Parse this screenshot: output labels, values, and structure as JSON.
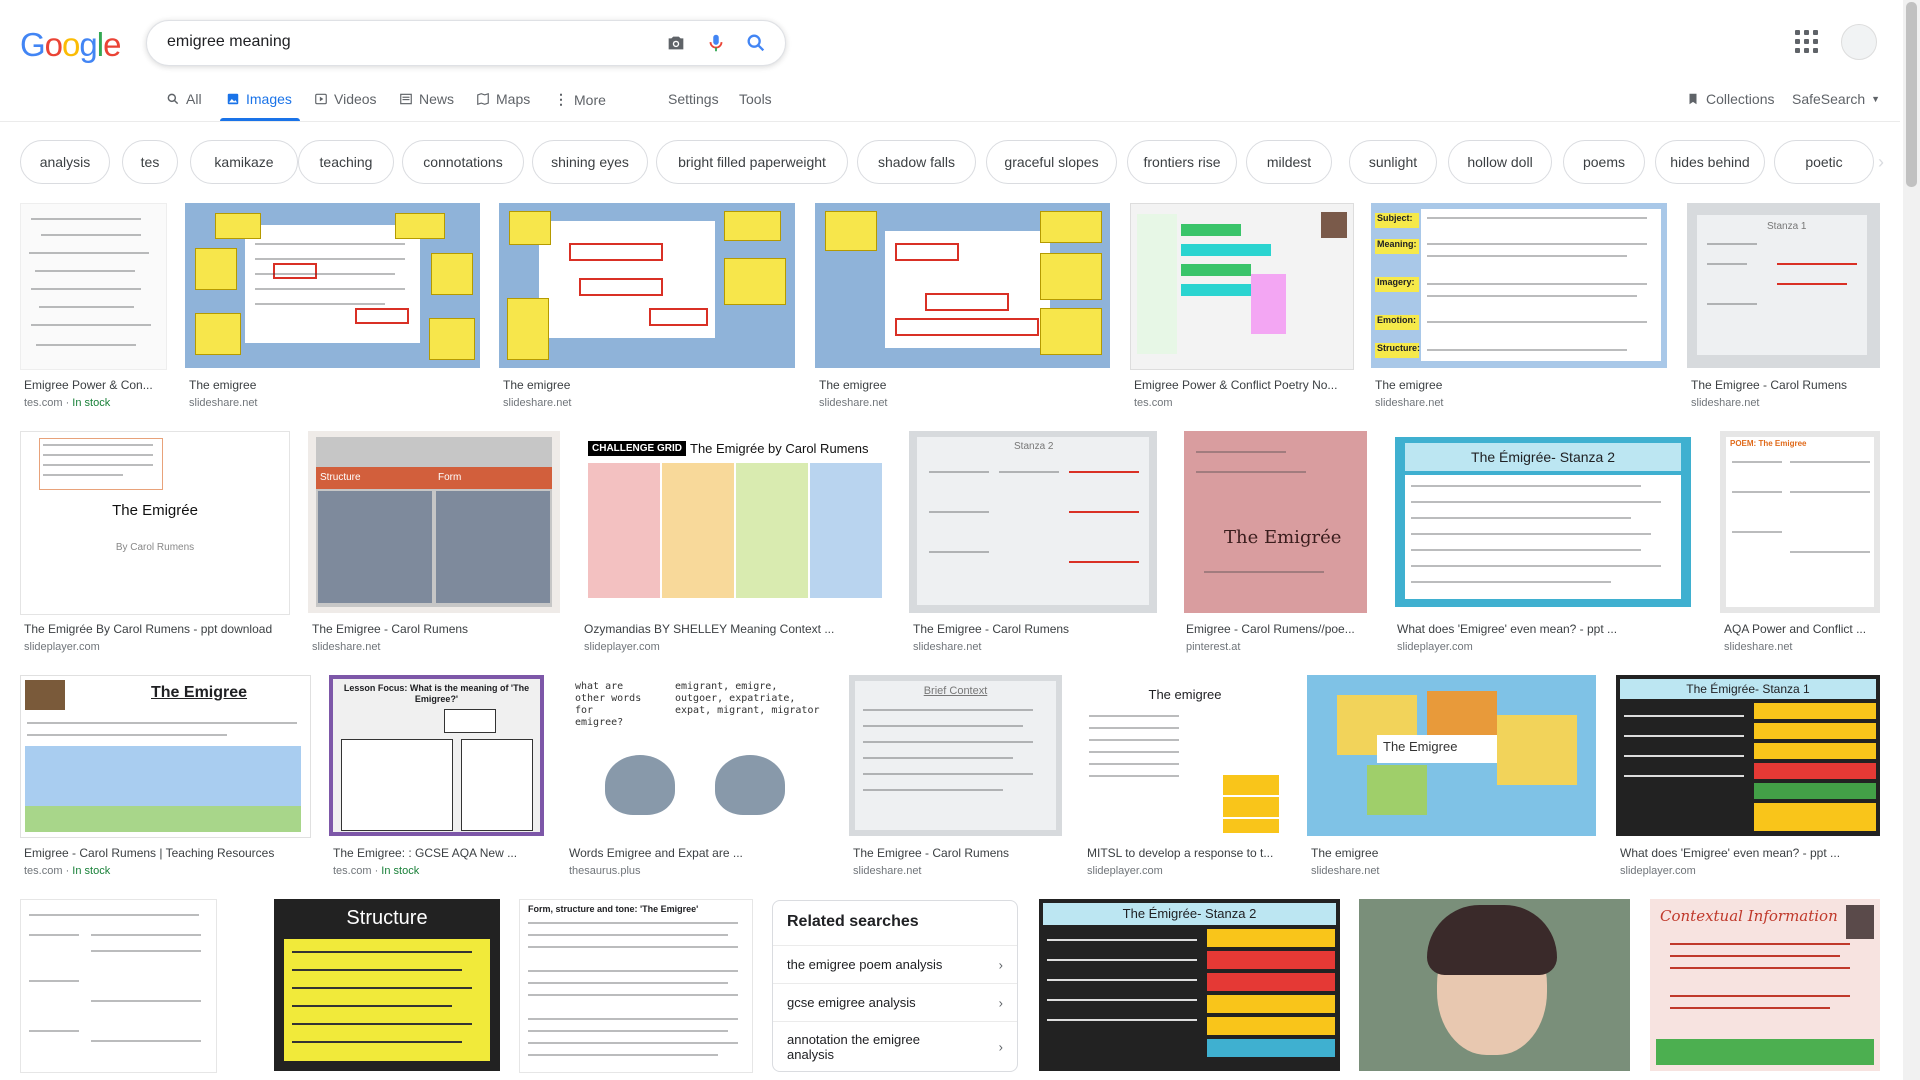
{
  "logo": {
    "letters": [
      "G",
      "o",
      "o",
      "g",
      "l",
      "e"
    ],
    "colors": [
      "#4285F4",
      "#EA4335",
      "#FBBC05",
      "#4285F4",
      "#34A853",
      "#EA4335"
    ]
  },
  "search": {
    "query": "emigree meaning",
    "camera_icon": "camera-icon",
    "mic_icon": "mic-icon",
    "search_icon": "search-icon"
  },
  "tabs": [
    {
      "label": "All",
      "icon": "search-icon"
    },
    {
      "label": "Images",
      "icon": "image-icon",
      "active": true
    },
    {
      "label": "Videos",
      "icon": "video-icon"
    },
    {
      "label": "News",
      "icon": "news-icon"
    },
    {
      "label": "Maps",
      "icon": "map-icon"
    },
    {
      "label": "More",
      "icon": "more-icon"
    },
    {
      "label": "Settings"
    },
    {
      "label": "Tools"
    }
  ],
  "right_tools": {
    "collections": "Collections",
    "safesearch": "SafeSearch"
  },
  "chips": [
    "analysis",
    "tes",
    "kamikaze",
    "teaching",
    "connotations",
    "shining eyes",
    "bright filled paperweight",
    "shadow falls",
    "graceful slopes",
    "frontiers rise",
    "mildest",
    "sunlight",
    "hollow doll",
    "poems",
    "hides behind",
    "poetic"
  ],
  "results": [
    {
      "title": "Emigree Power & Con...",
      "source": "tes.com",
      "stock": "In stock"
    },
    {
      "title": "The emigree",
      "source": "slideshare.net"
    },
    {
      "title": "The emigree",
      "source": "slideshare.net"
    },
    {
      "title": "The emigree",
      "source": "slideshare.net"
    },
    {
      "title": "Emigree Power & Conflict Poetry No...",
      "source": "tes.com"
    },
    {
      "title": "The emigree",
      "source": "slideshare.net"
    },
    {
      "title": "The Emigree - Carol Rumens",
      "source": "slideshare.net"
    },
    {
      "title": "The Emigrée By Carol Rumens - ppt download",
      "source": "slideplayer.com"
    },
    {
      "title": "The Emigree - Carol Rumens",
      "source": "slideshare.net"
    },
    {
      "title": "Ozymandias BY SHELLEY Meaning Context ...",
      "source": "slideplayer.com"
    },
    {
      "title": "The Emigree - Carol Rumens",
      "source": "slideshare.net"
    },
    {
      "title": "Emigree - Carol Rumens//poe...",
      "source": "pinterest.at"
    },
    {
      "title": "What does 'Emigree' even mean? - ppt ...",
      "source": "slideplayer.com"
    },
    {
      "title": "AQA Power and Conflict ...",
      "source": "slideshare.net"
    },
    {
      "title": "Emigree - Carol Rumens | Teaching Resources",
      "source": "tes.com",
      "stock": "In stock"
    },
    {
      "title": "The Emigree: : GCSE AQA New ...",
      "source": "tes.com",
      "stock": "In stock"
    },
    {
      "title": "Words Emigree and Expat are ...",
      "source": "thesaurus.plus"
    },
    {
      "title": "The Emigree - Carol Rumens",
      "source": "slideshare.net"
    },
    {
      "title": "MITSL to develop a response to t...",
      "source": "slideplayer.com"
    },
    {
      "title": "The emigree",
      "source": "slideshare.net"
    },
    {
      "title": "What does 'Emigree' even mean? - ppt ...",
      "source": "slideplayer.com"
    }
  ],
  "thumb_text": {
    "t8_title": "The Emigrée",
    "t8_sub": "By Carol Rumens",
    "t10_banner": "CHALLENGE GRID",
    "t10_title": "The Emigrée by Carol Rumens",
    "t9_left": "Structure",
    "t9_right": "Form",
    "t13_title": "The Émigrée- Stanza 2",
    "t15_title": "The Emigree",
    "t16_title": "Lesson Focus: What is the meaning of 'The Emigree?'",
    "t17_left": "what are other words for emigree?",
    "t17_right": "emigrant, emigre, outgoer, expatriate, expat, migrant, migrator",
    "t18_title": "Brief Context",
    "t19_title": "The emigree",
    "t20_title": "The Emigree",
    "t21_title": "The Émigrée- Stanza 1",
    "t23_title": "Structure",
    "t26_title": "The Émigrée- Stanza 2",
    "t28_title": "Contextual Information",
    "t6_labels": [
      "Subject:",
      "Meaning:",
      "Imagery:",
      "Emotion:",
      "Structure:"
    ],
    "t7_title": "Stanza 1",
    "t11_title": "Stanza 2",
    "t12_title": "The Emigrée",
    "t14_title": "POEM: The Emigree",
    "t24_title": "Form, structure and tone: 'The Emigree'"
  },
  "related": {
    "heading": "Related searches",
    "items": [
      "the emigree poem analysis",
      "gcse emigree analysis",
      "annotation the emigree analysis"
    ]
  }
}
